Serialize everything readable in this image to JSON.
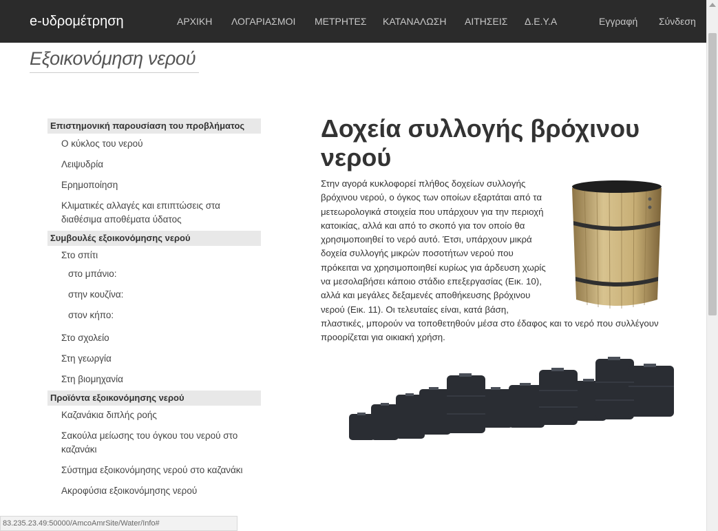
{
  "navbar": {
    "brand": "e-υδρομέτρηση",
    "links": [
      "ΑΡΧΙΚΗ",
      "ΛΟΓΑΡΙΑΣΜΟΙ",
      "ΜΕΤΡΗΤΕΣ",
      "ΚΑΤΑΝΑΛΩΣΗ",
      "ΑΙΤΗΣΕΙΣ",
      "Δ.Ε.Υ.Α"
    ],
    "register": "Εγγραφή",
    "login": "Σύνδεση"
  },
  "page": {
    "title": "Εξοικονόμηση νερού"
  },
  "sidebar": {
    "section1": {
      "header": "Επιστημονική παρουσίαση του προβλήματος",
      "items": [
        "Ο κύκλος του νερού",
        "Λειψυδρία",
        "Ερημοποίηση",
        "Κλιματικές αλλαγές και επιπτώσεις στα διαθέσιμα αποθέματα ύδατος"
      ]
    },
    "section2": {
      "header": "Συμβουλές εξοικονόμησης νερού",
      "home": "Στο σπίτι",
      "subitems": [
        "στο μπάνιο:",
        "στην κουζίνα:",
        "στον κήπο:"
      ],
      "items": [
        "Στο σχολείο",
        "Στη γεωργία",
        "Στη βιομηχανία"
      ]
    },
    "section3": {
      "header": "Προϊόντα εξοικονόμησης νερού",
      "items": [
        "Καζανάκια διπλής ροής",
        "Σακούλα μείωσης του όγκου του νερού στο καζανάκι",
        "Σύστημα εξοικονόμησης νερού στο καζανάκι",
        "Ακροφύσια εξοικονόμησης νερού"
      ]
    }
  },
  "article": {
    "heading": "Δοχεία συλλογής βρόχινου νερού",
    "body": "Στην αγορά κυκλοφορεί πλήθος δοχείων συλλογής βρόχινου νερού, ο όγκος των οποίων εξαρτάται από τα μετεωρολογικά στοιχεία που υπάρχουν για την περιοχή κατοικίας, αλλά και από το σκοπό για τον οποίο θα χρησιμοποιηθεί το νερό αυτό. Έτσι, υπάρχουν μικρά δοχεία συλλογής μικρών ποσοτήτων νερού που πρόκειται να χρησιμοποιηθεί κυρίως για άρδευση χωρίς να μεσολαβήσει κάποιο στάδιο επεξεργασίας (Εικ. 10), αλλά και μεγάλες δεξαμενές αποθήκευσης βρόχινου νερού (Εικ. 11). Οι τελευταίες είναι, κατά βάση, πλαστικές, μπορούν να τοποθετηθούν μέσα στο έδαφος και το νερό που συλλέγουν προορίζεται για οικιακή χρήση."
  },
  "status": {
    "url": "83.235.23.49:50000/AmcoAmrSite/Water/Info#"
  },
  "colors": {
    "navbar": "#2b2b2b",
    "sidebar_header": "#e8e8e8",
    "wood": "#c9b27a",
    "tank": "#2a2d33"
  }
}
